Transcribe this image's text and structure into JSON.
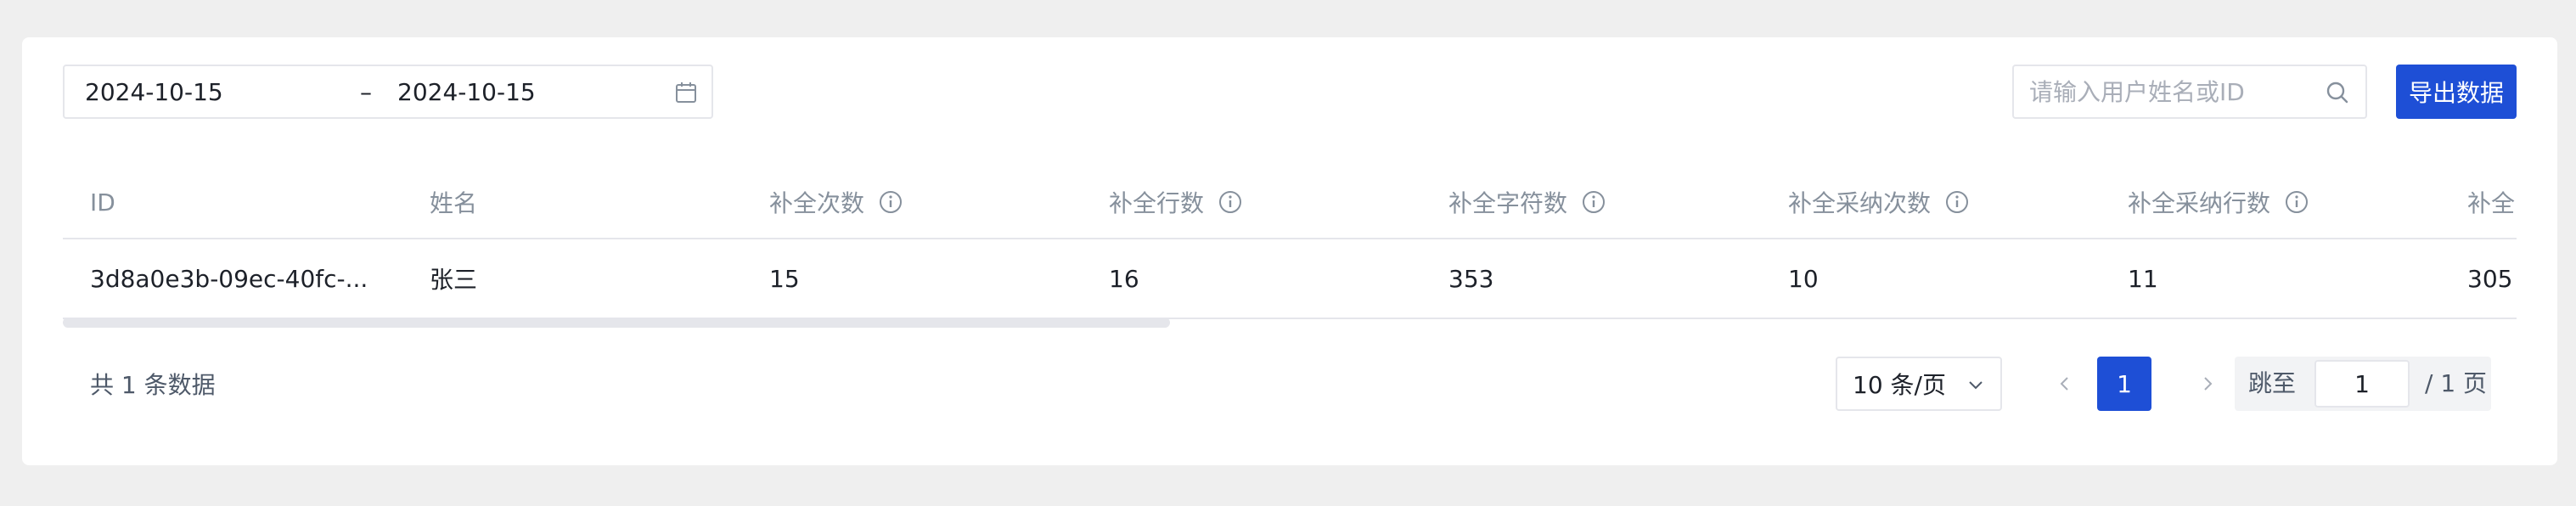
{
  "filters": {
    "date_start": "2024-10-15",
    "date_separator": "–",
    "date_end": "2024-10-15",
    "search_placeholder": "请输入用户姓名或ID",
    "export_label": "导出数据"
  },
  "table": {
    "columns": [
      {
        "label": "ID",
        "has_info": false
      },
      {
        "label": "姓名",
        "has_info": false
      },
      {
        "label": "补全次数",
        "has_info": true
      },
      {
        "label": "补全行数",
        "has_info": true
      },
      {
        "label": "补全字符数",
        "has_info": true
      },
      {
        "label": "补全采纳次数",
        "has_info": true
      },
      {
        "label": "补全采纳行数",
        "has_info": true
      },
      {
        "label": "补全",
        "has_info": false
      }
    ],
    "rows": [
      [
        "3d8a0e3b-09ec-40fc-...",
        "张三",
        "15",
        "16",
        "353",
        "10",
        "11",
        "305"
      ]
    ]
  },
  "footer": {
    "total_text": "共 1 条数据",
    "page_size": "10 条/页",
    "current_page": "1",
    "jump_label": "跳至",
    "jump_value": "1",
    "page_total": "/ 1 页"
  },
  "colors": {
    "primary": "#1e4fd6",
    "header_text": "#86909c",
    "border": "#e5e6eb"
  }
}
